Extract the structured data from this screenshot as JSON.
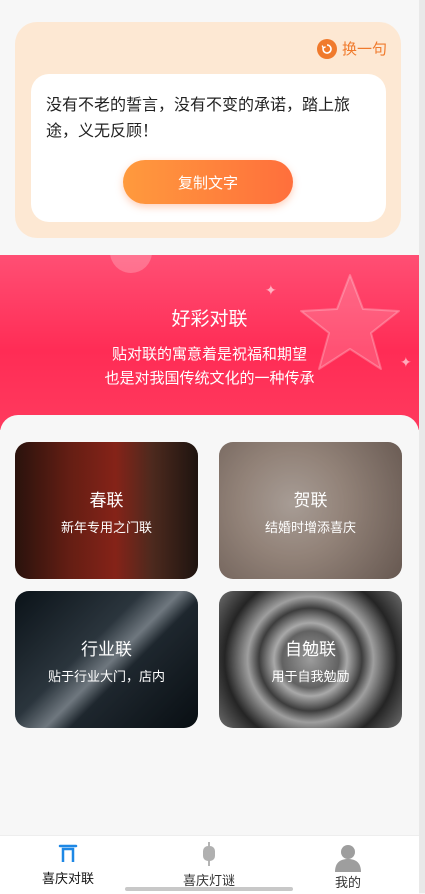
{
  "quote_card": {
    "refresh_label": "换一句",
    "quote": "没有不老的誓言，没有不变的承诺，踏上旅途，义无反顾！",
    "copy_button": "复制文字"
  },
  "banner": {
    "title": "好彩对联",
    "line1": "贴对联的寓意着是祝福和期望",
    "line2": "也是对我国传统文化的一种传承"
  },
  "categories": [
    {
      "title": "春联",
      "subtitle": "新年专用之门联"
    },
    {
      "title": "贺联",
      "subtitle": "结婚时增添喜庆"
    },
    {
      "title": "行业联",
      "subtitle": "贴于行业大门，店内"
    },
    {
      "title": "自勉联",
      "subtitle": "用于自我勉励"
    }
  ],
  "tabbar": {
    "tabs": [
      {
        "label": "喜庆对联",
        "icon": "door-arch-icon",
        "active": true
      },
      {
        "label": "喜庆灯谜",
        "icon": "lantern-icon",
        "active": false
      },
      {
        "label": "我的",
        "icon": "user-icon",
        "active": false
      }
    ]
  },
  "colors": {
    "accent_orange": "#f07a2c",
    "banner_red": "#ff2c55",
    "tab_active": "#1e88e5"
  }
}
